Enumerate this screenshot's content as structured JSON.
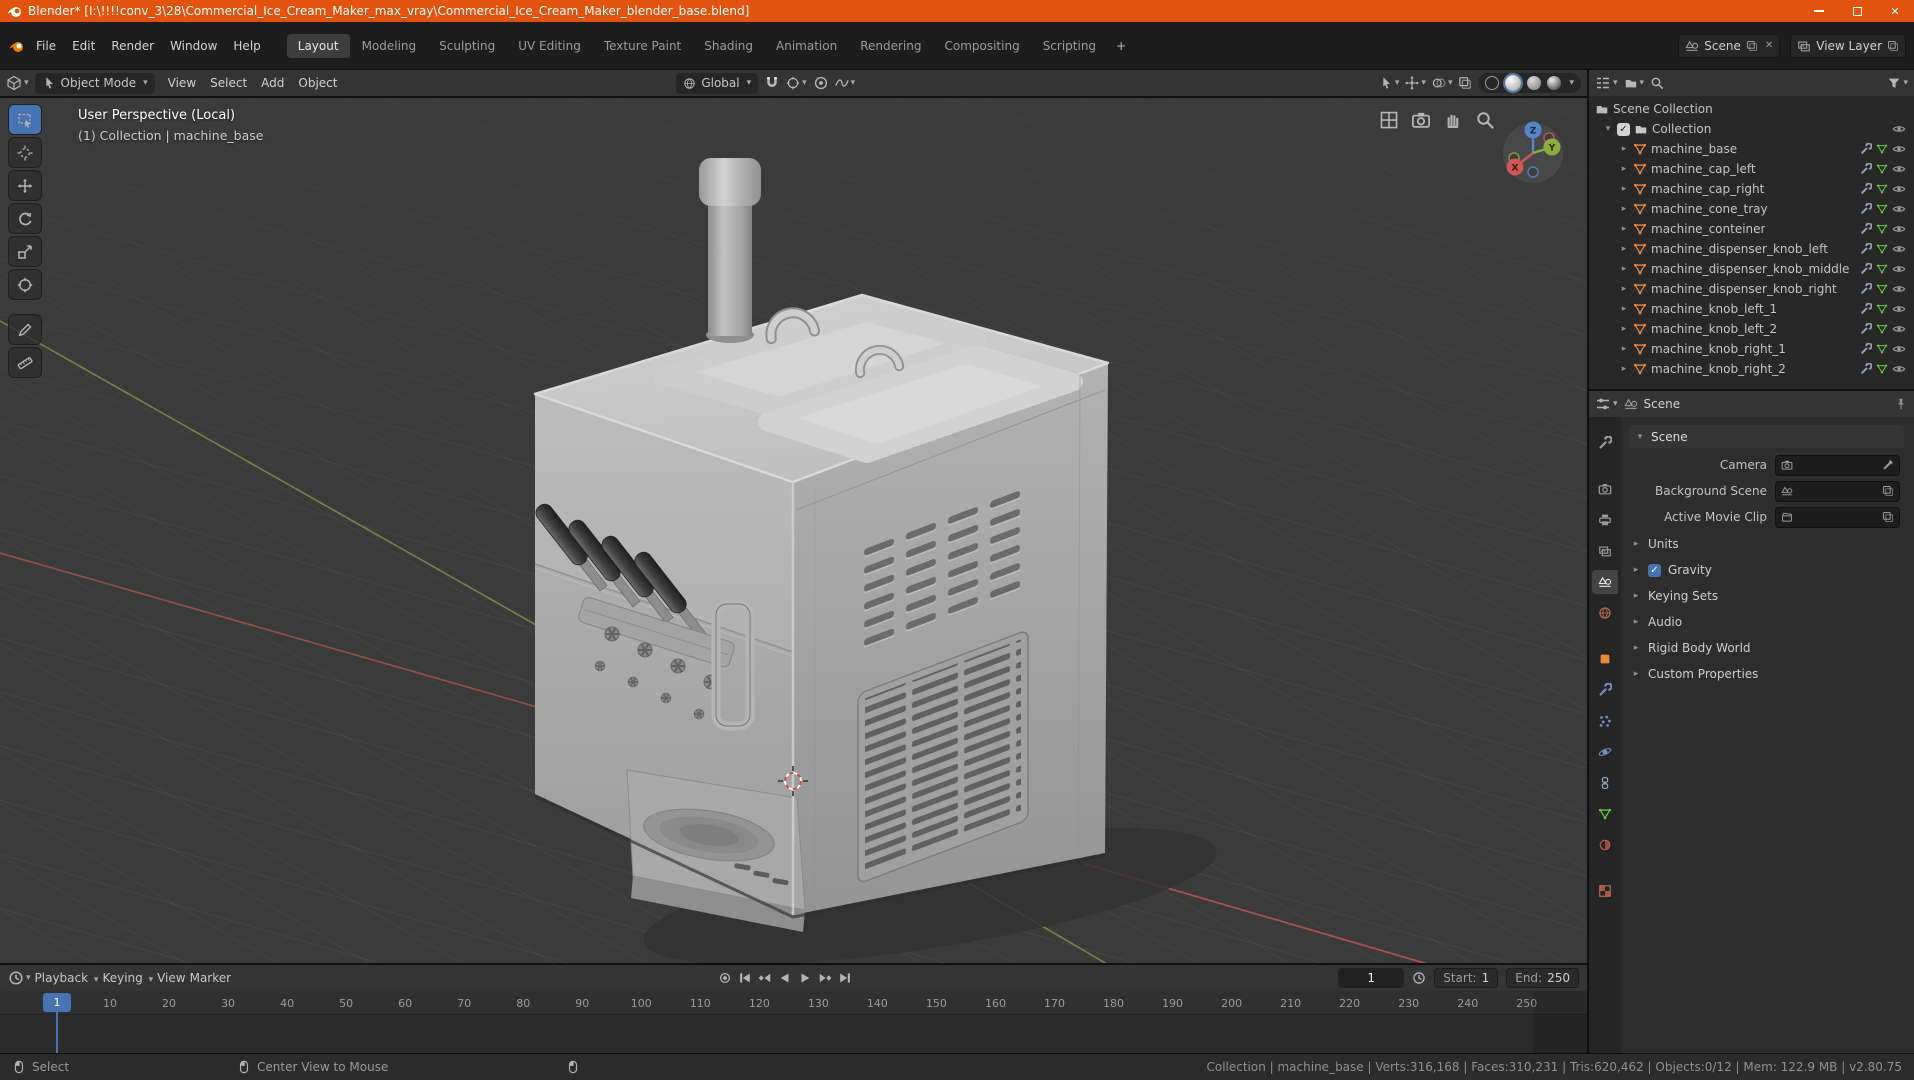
{
  "window": {
    "title": "Blender* [I:\\!!!!conv_3\\28\\Commercial_Ice_Cream_Maker_max_vray\\Commercial_Ice_Cream_Maker_blender_base.blend]"
  },
  "topbar": {
    "menus": [
      "File",
      "Edit",
      "Render",
      "Window",
      "Help"
    ],
    "active_tab": "Layout",
    "tabs": [
      "Modeling",
      "Sculpting",
      "UV Editing",
      "Texture Paint",
      "Shading",
      "Animation",
      "Rendering",
      "Compositing",
      "Scripting"
    ],
    "add_tab_label": "+",
    "scene_name": "Scene",
    "view_layer_name": "View Layer"
  },
  "tool_header": {
    "mode": "Object Mode",
    "menus": [
      "View",
      "Select",
      "Add",
      "Object"
    ],
    "orientation": "Global"
  },
  "viewport": {
    "overlay_line1": "User Perspective (Local)",
    "overlay_line2": "(1) Collection | machine_base",
    "axis_labels": {
      "x": "X",
      "y": "Y",
      "z": "Z"
    }
  },
  "outliner": {
    "root": "Scene Collection",
    "collection": "Collection",
    "items": [
      "machine_base",
      "machine_cap_left",
      "machine_cap_right",
      "machine_cone_tray",
      "machine_conteiner",
      "machine_dispenser_knob_left",
      "machine_dispenser_knob_middle",
      "machine_dispenser_knob_right",
      "machine_knob_left_1",
      "machine_knob_left_2",
      "machine_knob_right_1",
      "machine_knob_right_2"
    ]
  },
  "properties": {
    "breadcrumb": "Scene",
    "panel_scene": "Scene",
    "field_camera": "Camera",
    "field_background": "Background Scene",
    "field_movie_clip": "Active Movie Clip",
    "sections": [
      "Units",
      "Gravity",
      "Keying Sets",
      "Audio",
      "Rigid Body World",
      "Custom Properties"
    ]
  },
  "timeline": {
    "menus": [
      "Playback",
      "Keying",
      "View",
      "Marker"
    ],
    "current_frame": "1",
    "start_label": "Start:",
    "start_value": "1",
    "end_label": "End:",
    "end_value": "250",
    "ticks": [
      "10",
      "20",
      "30",
      "40",
      "50",
      "60",
      "70",
      "80",
      "90",
      "100",
      "110",
      "120",
      "130",
      "140",
      "150",
      "160",
      "170",
      "180",
      "190",
      "200",
      "210",
      "220",
      "230",
      "240",
      "250"
    ]
  },
  "status": {
    "select": "Select",
    "center_view": "Center View to Mouse",
    "stats": "Collection | machine_base | Verts:316,168 | Faces:310,231 | Tris:620,462 | Objects:0/12 | Mem: 122.9 MB | v2.80.75"
  },
  "colors": {
    "accent": "#4772b3",
    "titlebar": "#e1530e",
    "mesh_icon": "#e8883b",
    "data_icon": "#63c048",
    "axis_x": "#b05252",
    "axis_y": "#7b8b45",
    "axis_z": "#5585c9"
  },
  "icons": {
    "close": "✕",
    "check": "✓",
    "dropdown": "▾",
    "expand": "▸",
    "collapse": "▾"
  }
}
